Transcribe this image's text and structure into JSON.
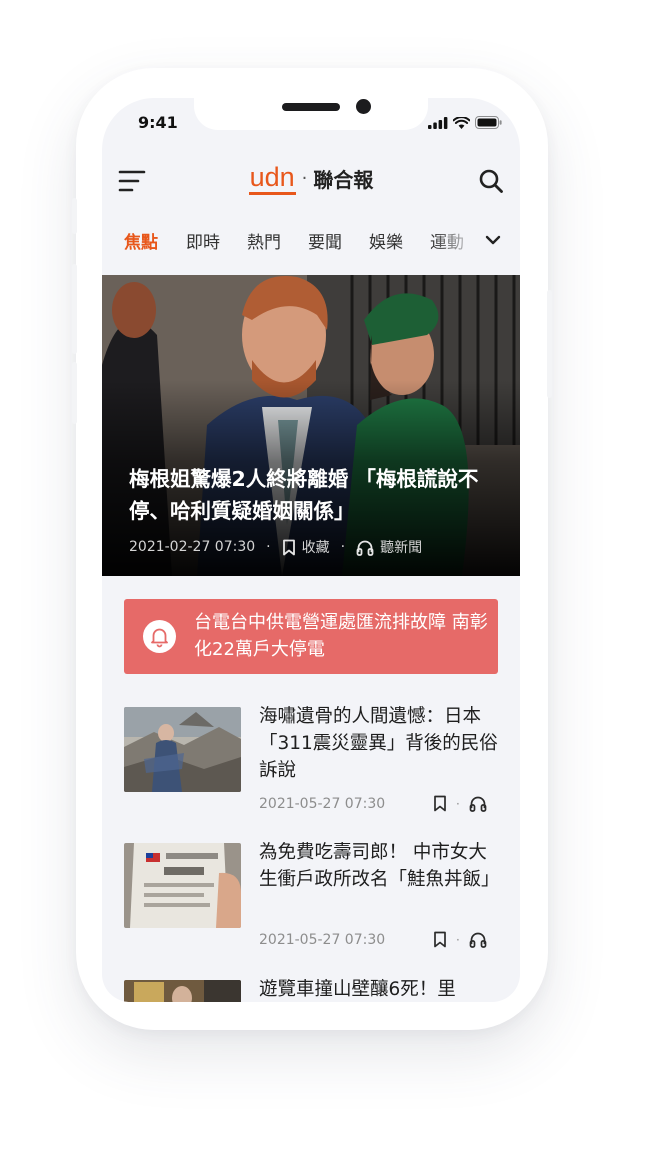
{
  "status_bar": {
    "time": "9:41"
  },
  "header": {
    "logo_brand": "udn",
    "logo_separator": "·",
    "logo_name": "聯合報"
  },
  "tabs": [
    {
      "label": "焦點",
      "active": true
    },
    {
      "label": "即時",
      "active": false
    },
    {
      "label": "熱門",
      "active": false
    },
    {
      "label": "要聞",
      "active": false
    },
    {
      "label": "娛樂",
      "active": false
    },
    {
      "label": "運動",
      "active": false
    }
  ],
  "featured": {
    "title": "梅根姐驚爆2人終將離婚 「梅根謊說不停、哈利質疑婚姻關係」",
    "date": "2021-02-27 07:30",
    "separator": "·",
    "bookmark_label": "收藏",
    "listen_label": "聽新聞"
  },
  "alert": {
    "text": "台電台中供電營運處匯流排故障 南彰化22萬戶大停電"
  },
  "news": [
    {
      "title": "海嘯遺骨的人間遺憾：日本「311震災靈異」背後的民俗訴說",
      "date": "2021-05-27 07:30"
    },
    {
      "title": "為免費吃壽司郎！ 中市女大生衝戶政所改名「鮭魚丼飯」",
      "date": "2021-05-27 07:30"
    },
    {
      "title": "遊覽車撞山壁釀6死！里"
    }
  ],
  "colors": {
    "accent": "#e8571b",
    "alert_bg": "#e66a68",
    "screen_bg": "#f3f4f8"
  },
  "icons": [
    "menu-icon",
    "search-icon",
    "chevron-down-icon",
    "bookmark-icon",
    "headphones-icon",
    "bell-icon",
    "signal-icon",
    "wifi-icon",
    "battery-icon"
  ]
}
